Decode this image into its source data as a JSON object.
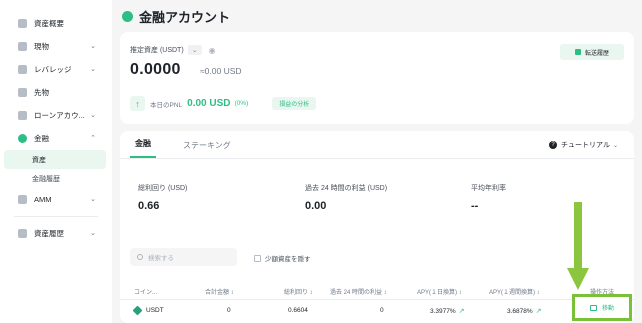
{
  "sidebar": {
    "items": [
      {
        "label": "資産概要",
        "icon": "overview-icon"
      },
      {
        "label": "現物",
        "icon": "spot-icon",
        "chevron": true
      },
      {
        "label": "レバレッジ",
        "icon": "margin-icon",
        "chevron": true
      },
      {
        "label": "先物",
        "icon": "futures-icon"
      },
      {
        "label": "ローンアカウ...",
        "icon": "loan-icon",
        "chevron": true
      },
      {
        "label": "金融",
        "icon": "earn-icon",
        "chevron": true,
        "expanded": true
      },
      {
        "label": "AMM",
        "icon": "amm-icon",
        "chevron": true
      },
      {
        "label": "資産履歴",
        "icon": "history-icon",
        "chevron": true
      }
    ],
    "earn_sub": [
      "資産",
      "金融履歴"
    ]
  },
  "header": {
    "title": "金融アカウント"
  },
  "summary": {
    "est_label": "推定資産 (USDT)",
    "est_value": "0.0000",
    "est_usd": "≈0.00 USD",
    "transfer_history": "転送履歴",
    "pnl_label": "本日のPNL",
    "pnl_value": "0.00 USD",
    "pnl_pct": "(0%)",
    "analysis_button": "損益の分析"
  },
  "tabs": [
    "金融",
    "ステーキング"
  ],
  "tutorial": "チュートリアル",
  "stats": [
    {
      "label": "総利回り (USD)",
      "value": "0.66"
    },
    {
      "label": "過去 24 時間の利益 (USD)",
      "value": "0.00"
    },
    {
      "label": "平均年利率",
      "value": "--"
    }
  ],
  "search": {
    "placeholder": "検索する"
  },
  "hide_small": "少額資産を隠す",
  "table": {
    "headers": [
      "コイン...",
      "合計金額 ↕",
      "総利回り ↕",
      "過去 24 時間の利益 ↕",
      "APY(１日換算) ↕",
      "APY(１週間換算) ↕",
      "操作方法"
    ],
    "rows": [
      {
        "coin": "USDT",
        "total": "0",
        "yield": "0.6604",
        "profit24h": "0",
        "apy1d": "3.3977%",
        "apy7d": "3.6878%",
        "action": "移動"
      }
    ]
  },
  "colors": {
    "accent": "#2ebd85",
    "annotation": "#8cc63f"
  }
}
